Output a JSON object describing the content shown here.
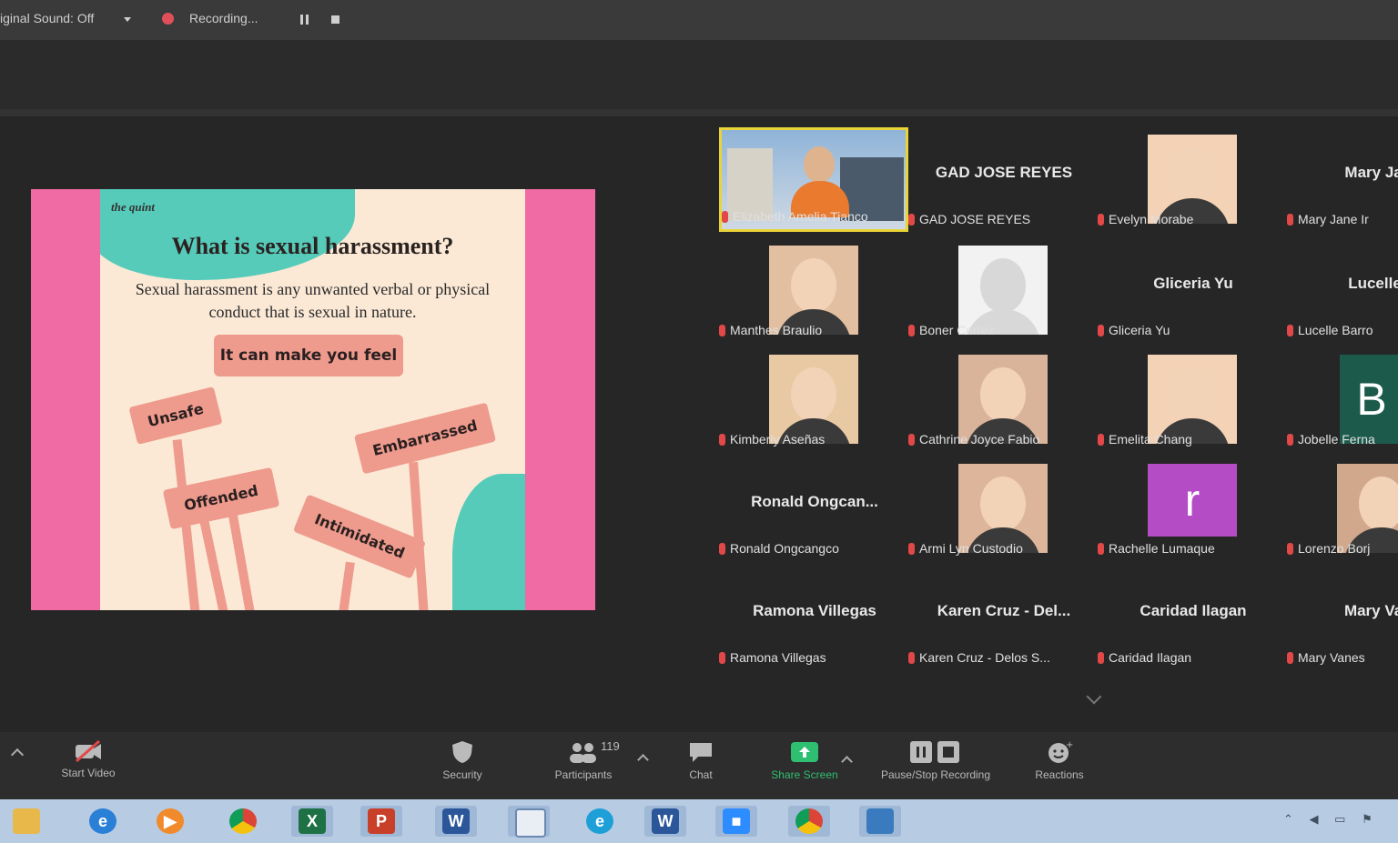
{
  "top_bar": {
    "sound_label": "iginal Sound: Off",
    "recording_label": "Recording..."
  },
  "slide": {
    "brand": "the quint",
    "title": "What is sexual harassment?",
    "body": "Sexual harassment is any unwanted verbal or physical conduct that is sexual in nature.",
    "feel_label": "It can make you feel",
    "signs": [
      "Unsafe",
      "Embarrassed",
      "Offended",
      "Intimidated"
    ]
  },
  "participants": [
    {
      "big": "",
      "label": "Elizabeth Amelia Tianco",
      "kind": "video"
    },
    {
      "big": "GAD JOSE REYES",
      "label": "GAD JOSE REYES",
      "kind": "name"
    },
    {
      "big": "",
      "label": "Evelyn Morabe",
      "kind": "photo"
    },
    {
      "big": "Mary Jane",
      "label": "Mary Jane Ir",
      "kind": "name"
    },
    {
      "big": "",
      "label": "Manthes Braulio",
      "kind": "photo"
    },
    {
      "big": "",
      "label": "Boner Cortez",
      "kind": "silhouette"
    },
    {
      "big": "Gliceria Yu",
      "label": "Gliceria Yu",
      "kind": "name"
    },
    {
      "big": "Lucelle B",
      "label": "Lucelle Barro",
      "kind": "name"
    },
    {
      "big": "",
      "label": "Kimberly Aseñas",
      "kind": "photo"
    },
    {
      "big": "",
      "label": "Cathrine Joyce Fabio",
      "kind": "photo"
    },
    {
      "big": "",
      "label": "Emelita Chang",
      "kind": "photo"
    },
    {
      "big": "B",
      "label": "Jobelle Ferna",
      "kind": "avatar"
    },
    {
      "big": "Ronald Ongcan...",
      "label": "Ronald Ongcangco",
      "kind": "name"
    },
    {
      "big": "",
      "label": "Armi Lyn Custodio",
      "kind": "photo"
    },
    {
      "big": "r",
      "label": "Rachelle Lumaque",
      "kind": "avatar"
    },
    {
      "big": "",
      "label": "Lorenzo Borj",
      "kind": "photo"
    },
    {
      "big": "Ramona Villegas",
      "label": "Ramona Villegas",
      "kind": "name"
    },
    {
      "big": "Karen Cruz - Del...",
      "label": "Karen Cruz - Delos S...",
      "kind": "name"
    },
    {
      "big": "Caridad Ilagan",
      "label": "Caridad Ilagan",
      "kind": "name"
    },
    {
      "big": "Mary Vane",
      "label": "Mary Vanes",
      "kind": "name"
    }
  ],
  "toolbar": {
    "start_video": "Start Video",
    "security": "Security",
    "participants": "Participants",
    "participants_count": "119",
    "chat": "Chat",
    "share_screen": "Share Screen",
    "pause_stop": "Pause/Stop Recording",
    "reactions": "Reactions"
  },
  "taskbar": {
    "apps": [
      "file-explorer",
      "internet-explorer",
      "media-player",
      "chrome",
      "excel",
      "powerpoint",
      "word",
      "window",
      "edge",
      "word-2",
      "zoom",
      "chrome-2",
      "photos"
    ]
  },
  "colors": {
    "slide_pink": "#f06aa3",
    "slide_cream": "#fbe9d6",
    "slide_teal": "#56cbb9",
    "sign_salmon": "#ee9a8c",
    "active_speaker": "#e9d438",
    "share_green": "#2fbf71",
    "avatar_purple": "#b44cc5"
  }
}
